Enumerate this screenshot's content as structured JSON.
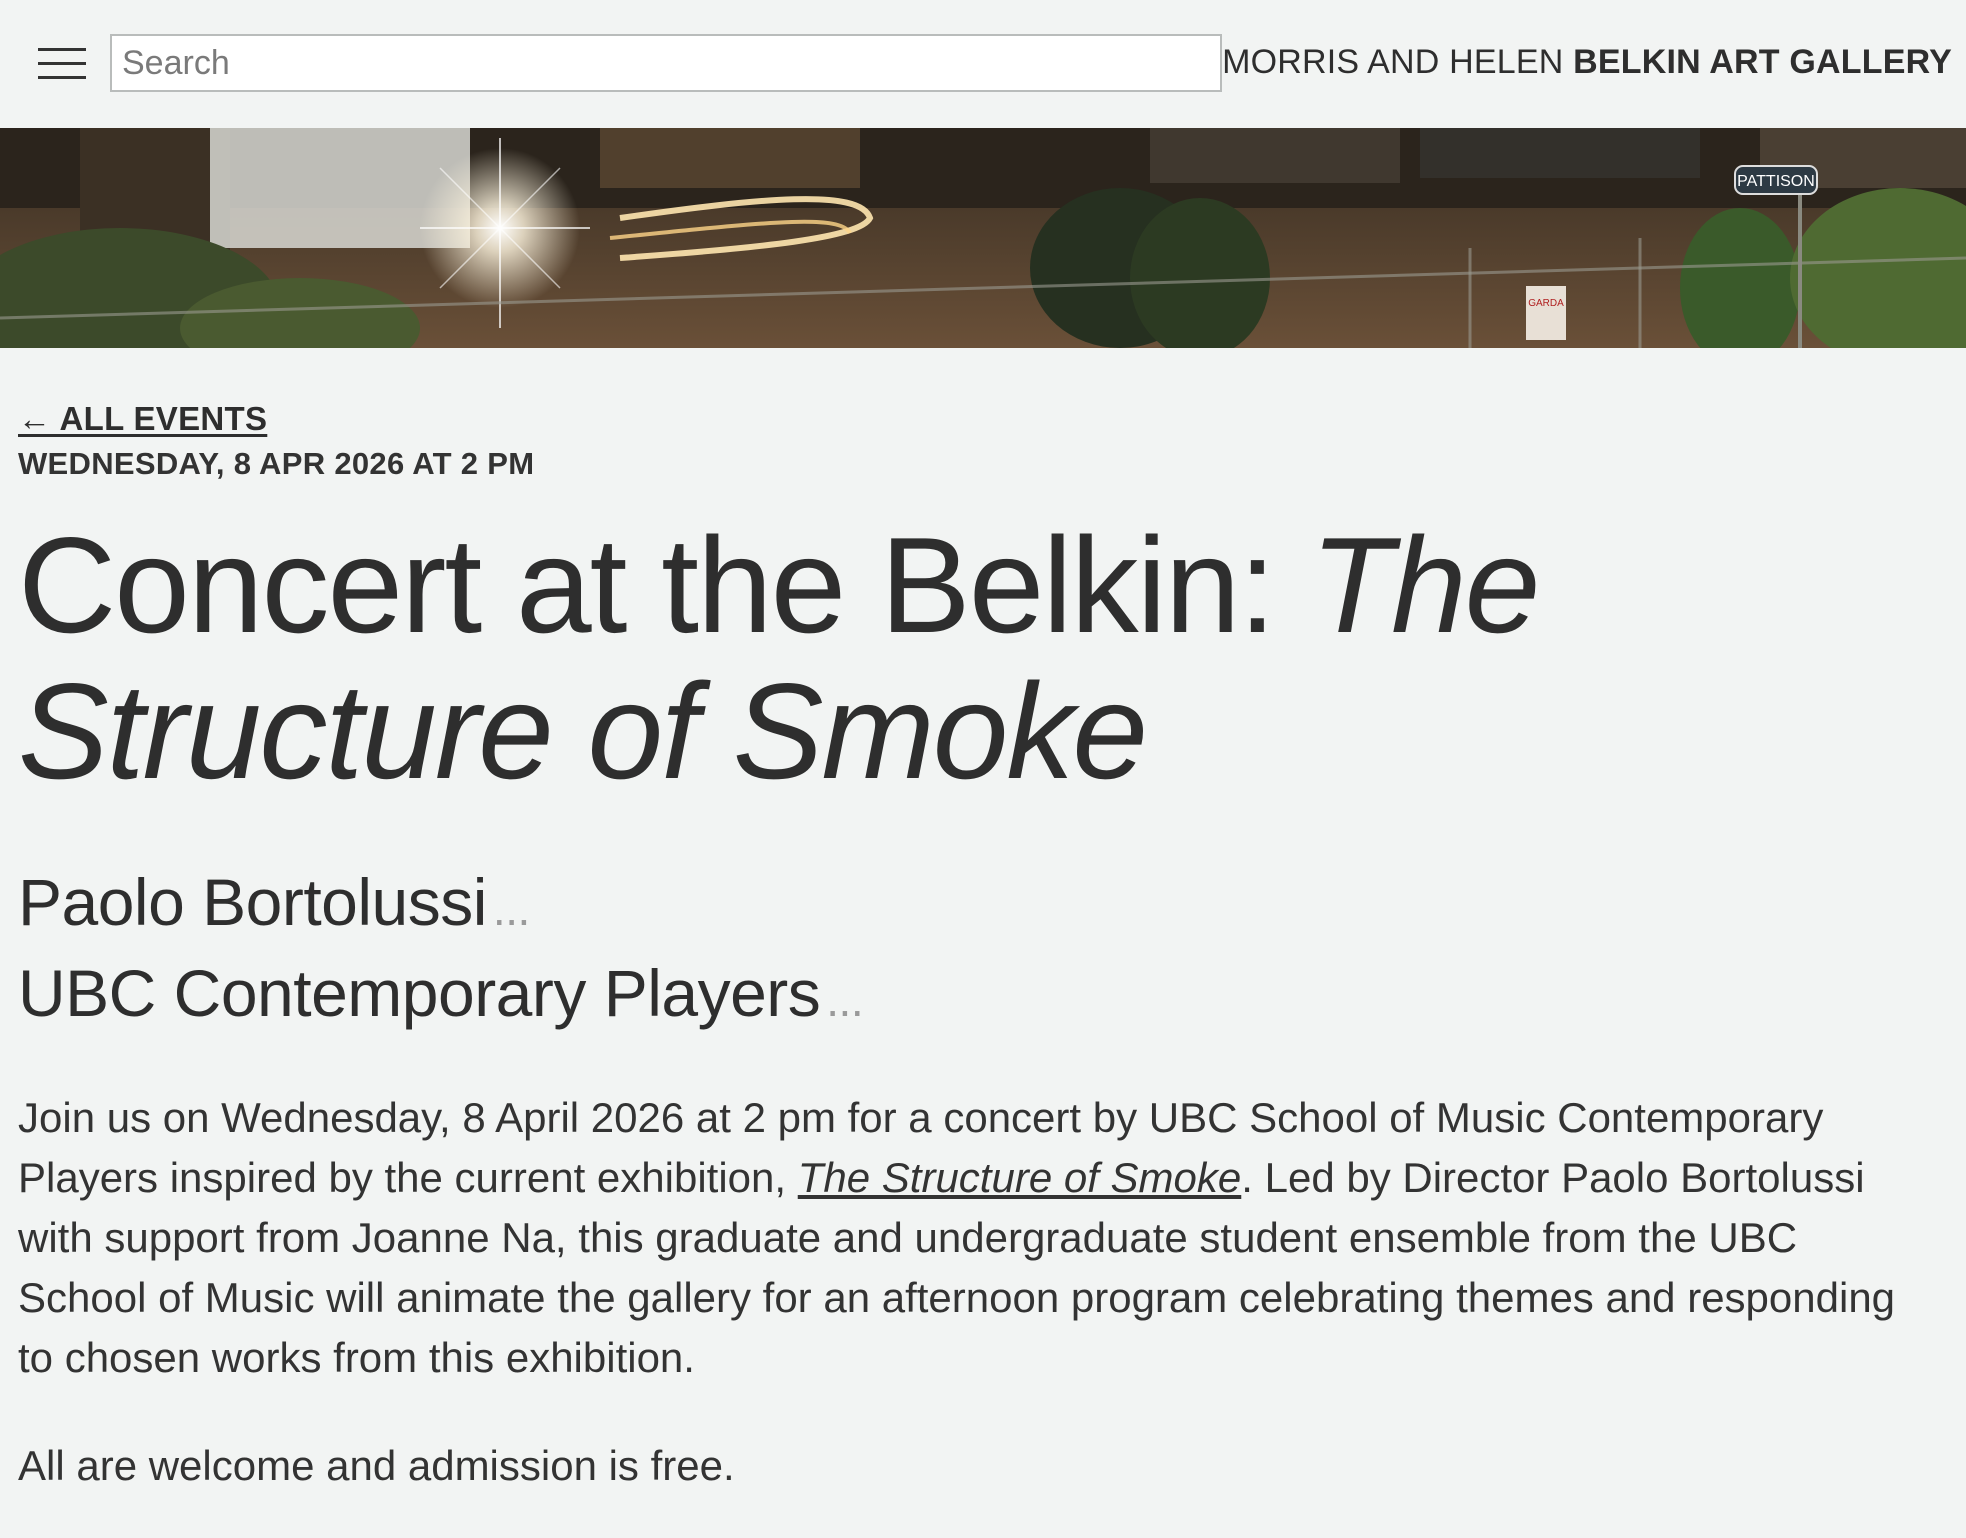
{
  "header": {
    "search_placeholder": "Search",
    "brand_light": "MORRIS AND HELEN ",
    "brand_bold": "BELKIN ART GALLERY"
  },
  "banner": {
    "street_sign": "PATTISON",
    "security_sign": "GARDA"
  },
  "event": {
    "back_label": "← ALL EVENTS",
    "date": "WEDNESDAY, 8 APR 2026 AT 2 PM",
    "title_plain": "Concert at the Belkin: ",
    "title_italic": "The Structure of Smoke",
    "people": [
      {
        "name": "Paolo Bortolussi",
        "more": "..."
      },
      {
        "name": "UBC Contemporary Players",
        "more": "..."
      }
    ],
    "description_before": "Join us on Wednesday, 8 April 2026 at 2 pm for a concert by UBC School of Music Contemporary Players inspired by the current exhibition, ",
    "description_link": "The Structure of Smoke",
    "description_after": ". Led by Director Paolo Bortolussi with support from Joanne Na, this graduate and undergraduate student ensemble from the UBC School of Music will animate the gallery for an afternoon program celebrating themes and responding to chosen works from this exhibition.",
    "welcome": "All are welcome and admission is free."
  }
}
